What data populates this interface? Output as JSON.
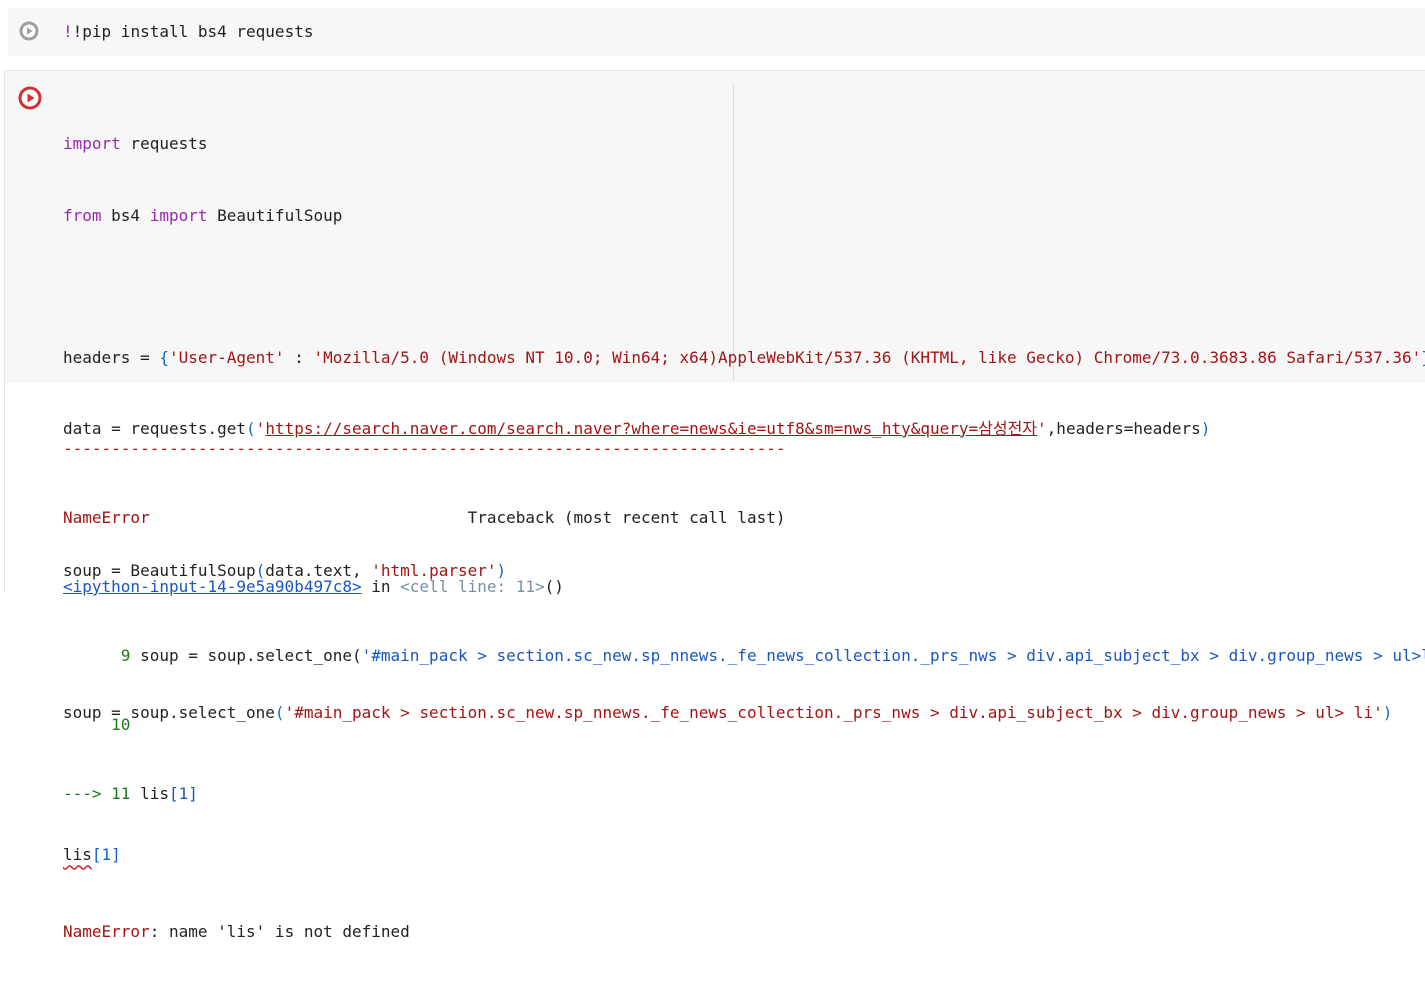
{
  "cell1": {
    "code": "!pip install bs4 requests"
  },
  "cell2": {
    "line1_kw": "import",
    "line1_rest": " requests",
    "line2_kw1": "from",
    "line2_mid": " bs4 ",
    "line2_kw2": "import",
    "line2_rest": " BeautifulSoup",
    "line4_a": "headers = ",
    "line4_brace_open": "{",
    "line4_key": "'User-Agent'",
    "line4_colon": " : ",
    "line4_val": "'Mozilla/5.0 (Windows NT 10.0; Win64; x64)AppleWebKit/537.36 (KHTML, like Gecko) Chrome/73.0.3683.86 Safari/537.36'",
    "line4_brace_close": "}",
    "line5_a": "data = requests.get",
    "line5_paren_open": "(",
    "line5_q1": "'",
    "line5_url": "https://search.naver.com/search.naver?where=news&ie=utf8&sm=nws_hty&query=삼성전자",
    "line5_q2": "'",
    "line5_rest": ",headers=headers",
    "line5_paren_close": ")",
    "line7_a": "soup = BeautifulSoup",
    "line7_paren_open": "(",
    "line7_b": "data.text, ",
    "line7_str": "'html.parser'",
    "line7_paren_close": ")",
    "line9_a": "soup = soup.select_one",
    "line9_paren_open": "(",
    "line9_str": "'#main_pack > section.sc_new.sp_nnews._fe_news_collection._prs_nws > div.api_subject_bx > div.group_news > ul> li'",
    "line9_paren_close": ")",
    "line11_name": "lis",
    "line11_bracket": "[1]"
  },
  "output": {
    "dashes": "---------------------------------------------------------------------------",
    "err_name": "NameError",
    "traceback_label": "                                 Traceback (most recent call last)",
    "input_link": "<ipython-input-14-9e5a90b497c8>",
    "in_word": " in ",
    "cell_line": "<cell line: 11>",
    "cell_parens": "()",
    "tb_line9_num": "      9 ",
    "tb_line9_code_a": "soup = soup.select_one(",
    "tb_line9_code_str": "'#main_pack > section.sc_new.sp_nnews._fe_news_collection._prs_nws > div.api_subject_bx > div.group_news > ul>li'",
    "tb_line9_code_b": ")",
    "tb_line10_num": "     10",
    "tb_arrow": "---> 11 ",
    "tb_line11_code": "lis",
    "tb_line11_bracket": "[1]",
    "final_err_name": "NameError",
    "final_err_msg": ": name 'lis' is not defined"
  }
}
